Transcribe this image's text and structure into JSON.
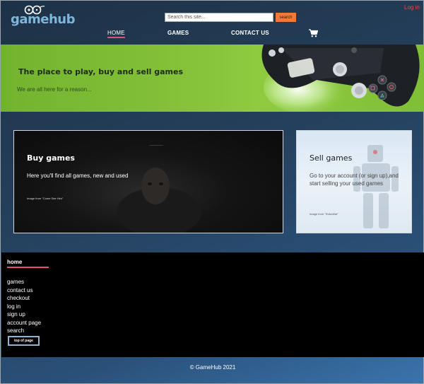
{
  "header": {
    "logo_text": "gamehub",
    "search": {
      "placeholder": "Search this site...",
      "button_label": "search"
    },
    "login_label": "Log in",
    "nav": [
      {
        "label": "HOME",
        "active": true
      },
      {
        "label": "GAMES",
        "active": false
      },
      {
        "label": "CONTACT US",
        "active": false
      }
    ],
    "cart_icon": "shopping-cart-icon"
  },
  "hero": {
    "title": "The place to play, buy and sell games",
    "subtitle": "We are all here for a reason..."
  },
  "cards": {
    "buy": {
      "title": "Buy games",
      "text": "Here you'll find all games, new and used",
      "credit": "Image from \"Come See Him\""
    },
    "sell": {
      "title": "Sell games",
      "text": "Go to your account (or sign up),and start selling your used games",
      "credit": "Image from \"RoboWar\""
    }
  },
  "footer_nav": {
    "home_label": "home",
    "links": [
      "games",
      "contact us",
      "checkout",
      "log in",
      "sign up",
      "account page",
      "search"
    ],
    "top_button_label": "top of page"
  },
  "footer": {
    "copyright": "© GameHub 2021"
  },
  "colors": {
    "accent_orange": "#f07a3c",
    "login_red": "#e8484d",
    "underline_pink": "#e0507a",
    "hero_green": "#86c23a"
  }
}
